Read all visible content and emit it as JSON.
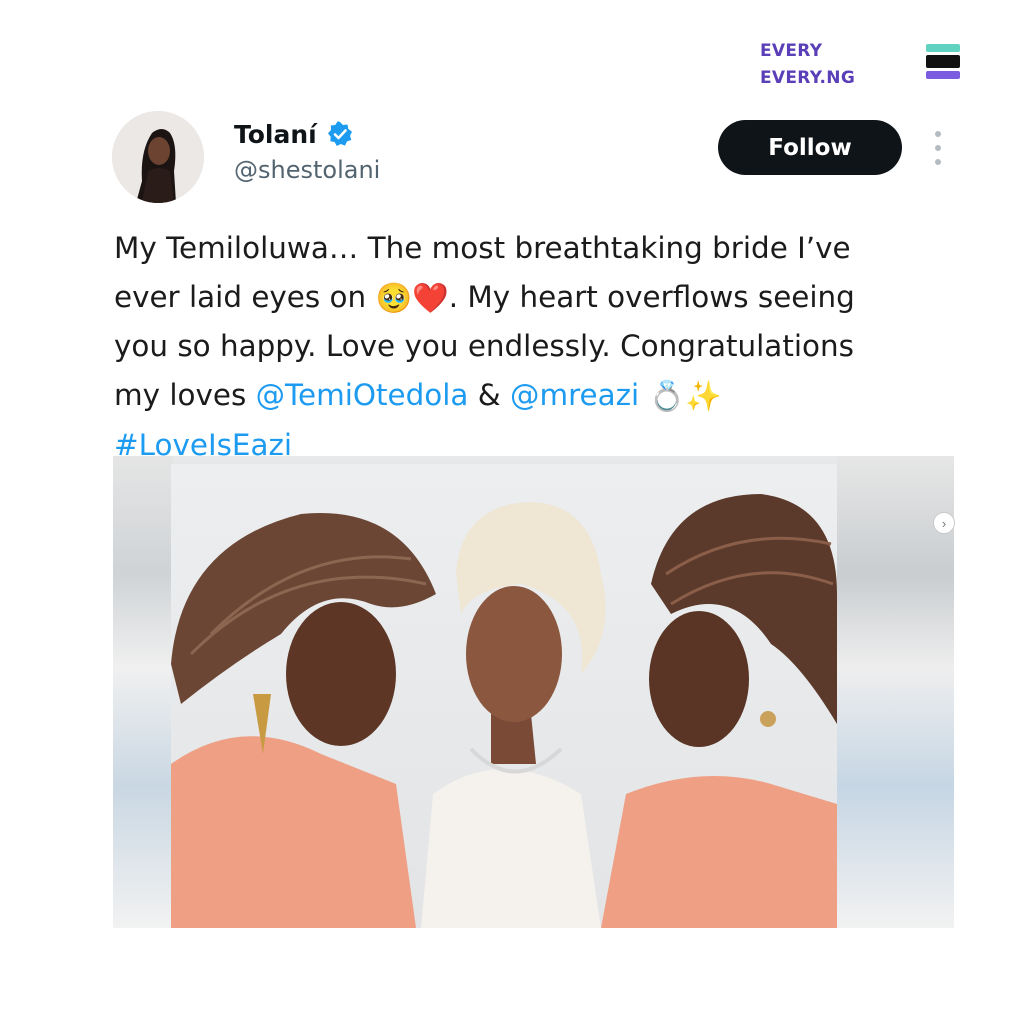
{
  "brand": {
    "line1": "EVERY",
    "line2": "EVERY.NG",
    "colors": {
      "text": "#5b3fb8",
      "bar_top": "#5fd3c0",
      "bar_mid": "#111111",
      "bar_bottom": "#7b5ce0"
    }
  },
  "tweet": {
    "author": {
      "display_name": "Tolaní",
      "handle": "@shestolani",
      "verified": true,
      "verified_color": "#1d9bf0"
    },
    "follow_label": "Follow",
    "menu_icon": "more-vertical-icon",
    "lines": [
      [
        {
          "text": "My Temiloluwa… The most breathtaking bride I’ve"
        }
      ],
      [
        {
          "text": "ever laid eyes on "
        },
        {
          "emoji": "🥹"
        },
        {
          "emoji": "❤️"
        },
        {
          "text": ". My heart overflows seeing"
        }
      ],
      [
        {
          "text": "you so happy. Love you endlessly. Congratulations"
        }
      ],
      [
        {
          "text": "my loves "
        },
        {
          "link": "@TemiOtedola"
        },
        {
          "text": " & "
        },
        {
          "link": "@mreazi"
        },
        {
          "text": " "
        },
        {
          "emoji": "💍"
        },
        {
          "emoji": "✨"
        }
      ],
      [
        {
          "link": "#LoveIsEazi"
        }
      ]
    ],
    "link_color": "#1d9bf0"
  },
  "media": {
    "carousel_icon": "chevron-right-icon"
  }
}
